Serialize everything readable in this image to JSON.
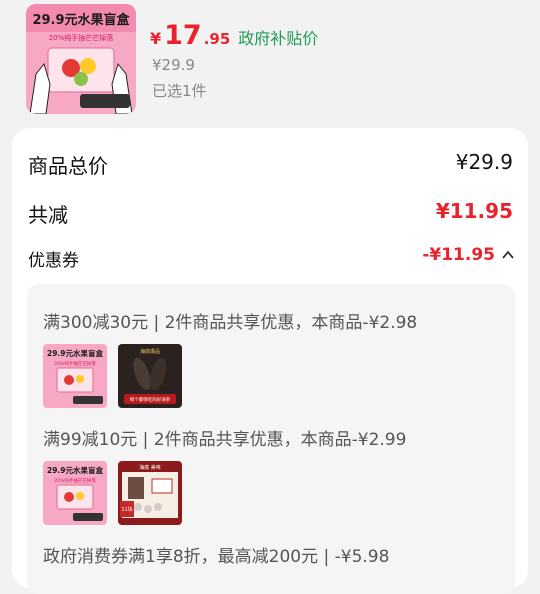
{
  "product": {
    "thumb_title": "29.9元水果盲盒",
    "thumb_sub": "20%纯手抽芒芒掉落",
    "price_currency": "¥",
    "price_int": "17",
    "price_dec": ".95",
    "subsidy_label": "政府补贴价",
    "original_price": "¥29.9",
    "quantity": "已选1件"
  },
  "summary": {
    "total_label": "商品总价",
    "total_value": "¥29.9",
    "reduce_label": "共减",
    "reduce_value": "¥11.95",
    "coupon_label": "优惠券",
    "coupon_value": "-¥11.95"
  },
  "coupons": [
    {
      "rule": "满300减30元 | 2件商品共享优惠，本商品-¥2.98"
    },
    {
      "rule": "满99减10元 | 2件商品共享优惠，本商品-¥2.99"
    },
    {
      "rule": "政府消费券满1享8折，最高减200元 | -¥5.98"
    }
  ],
  "thumbs": {
    "fruit_title": "29.9元水果盲盒",
    "fruit_sub": "20%纯手抽芒芒掉落",
    "seacucumber_top": "海底爆品",
    "seacucumber_label": "每个都够吃的好海参",
    "giftbox_top": "海底 美味",
    "giftbox_badge": "11块"
  },
  "colors": {
    "accent_red": "#e8232d",
    "green": "#1e9c55",
    "pink": "#f7a8c4"
  }
}
